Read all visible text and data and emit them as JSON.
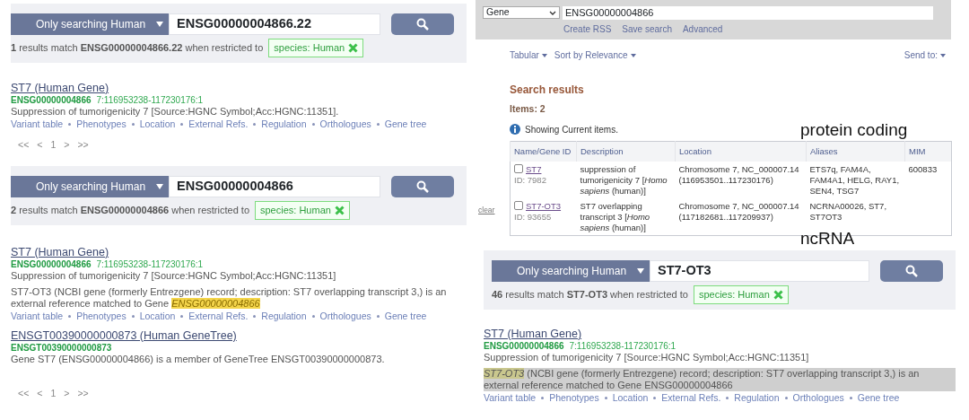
{
  "ensembl_panels": [
    {
      "search": {
        "species_dropdown": "Only searching Human",
        "query": "ENSG00000004866.22"
      },
      "summary": "**1** results match **ENSG00000004866.22** when restricted to",
      "filter_tag": "species: Human",
      "results": [
        {
          "title": "ST7 (Human Gene)",
          "stable_id": "ENSG00000004866",
          "location": "7:116953238-117230176:1",
          "description": "Suppression of tumorigenicity 7 [Source:HGNC Symbol;Acc:HGNC:11351].",
          "links": [
            "Variant table",
            "Phenotypes",
            "Location",
            "External Refs.",
            "Regulation",
            "Orthologues",
            "Gene tree"
          ]
        }
      ],
      "pager": [
        "<<",
        "<",
        "1",
        ">",
        ">>"
      ]
    },
    {
      "search": {
        "species_dropdown": "Only searching Human",
        "query": "ENSG00000004866"
      },
      "summary": "**2** results match **ENSG00000004866** when restricted to",
      "filter_tag": "species: Human",
      "results": [
        {
          "title": "ST7 (Human Gene)",
          "stable_id": "ENSG00000004866",
          "location": "7:116953238-117230176:1",
          "description": "Suppression of tumorigenicity 7 [Source:HGNC Symbol;Acc:HGNC:11351]",
          "xref": {
            "text": "ST7-OT3 (NCBI gene (formerly Entrezgene) record; description: ST7 overlapping transcript 3,) is an external reference matched to Gene *ENSG00000004866*",
            "highlighted": false
          },
          "links": [
            "Variant table",
            "Phenotypes",
            "Location",
            "External Refs.",
            "Regulation",
            "Orthologues",
            "Gene tree"
          ]
        },
        {
          "title": "ENSGT00390000000873 (Human GeneTree)",
          "stable_id": "ENSGT00390000000873",
          "description": "Gene ST7 (ENSG00000004866) is a member of GeneTree ENSGT00390000000873."
        }
      ],
      "pager": [
        "<<",
        "<",
        "1",
        ">",
        ">>"
      ]
    }
  ],
  "ncbi_panel": {
    "database_select": "Gene",
    "query": "ENSG00000004866",
    "search_links": [
      "Create RSS",
      "Save search",
      "Advanced"
    ],
    "toolbar": {
      "left": [
        "Tabular",
        "Sort by Relevance"
      ],
      "right": "Send to:"
    },
    "heading": "Search results",
    "items_count": "Items: 2",
    "info": "Showing Current items.",
    "clear_link": "clear",
    "table": {
      "columns": [
        "Name/Gene ID",
        "Description",
        "Location",
        "Aliases",
        "MIM"
      ],
      "rows": [
        {
          "checked": false,
          "name": "ST7",
          "gene_id": "ID: 7982",
          "description": "suppression of tumorigenicity 7 [*Homo sapiens* (human)]",
          "location": "Chromosome 7, NC_000007.14 (116953501..117230176)",
          "aliases": "ETS7q, FAM4A, FAM4A1, HELG, RAY1, SEN4, TSG7",
          "mim": "600833"
        },
        {
          "checked": false,
          "name": "ST7-OT3",
          "gene_id": "ID: 93655",
          "description": "ST7 overlapping transcript 3 [*Homo sapiens* (human)]",
          "location": "Chromosome 7, NC_000007.14 (117182681..117209937)",
          "aliases": "NCRNA00026, ST7, ST7OT3"
        }
      ]
    },
    "annotations": [
      "protein coding",
      "ncRNA"
    ]
  },
  "ensembl_panel_right": {
    "search": {
      "species_dropdown": "Only searching Human",
      "query": "ST7-OT3"
    },
    "summary": "**46** results match **ST7-OT3** when restricted to",
    "filter_tag": "species: Human",
    "results": [
      {
        "title": "ST7 (Human Gene)",
        "stable_id": "ENSG00000004866",
        "location": "7:116953238-117230176:1",
        "description": "Suppression of tumorigenicity 7 [Source:HGNC Symbol;Acc:HGNC:11351]",
        "xref": {
          "text": "*ST7-OT3* (NCBI gene (formerly Entrezgene) record; description: ST7 overlapping transcript 3,) is an external reference matched to Gene ENSG00000004866",
          "highlighted": true
        },
        "links": [
          "Variant table",
          "Phenotypes",
          "Location",
          "External Refs.",
          "Regulation",
          "Orthologues",
          "Gene tree"
        ]
      }
    ]
  }
}
